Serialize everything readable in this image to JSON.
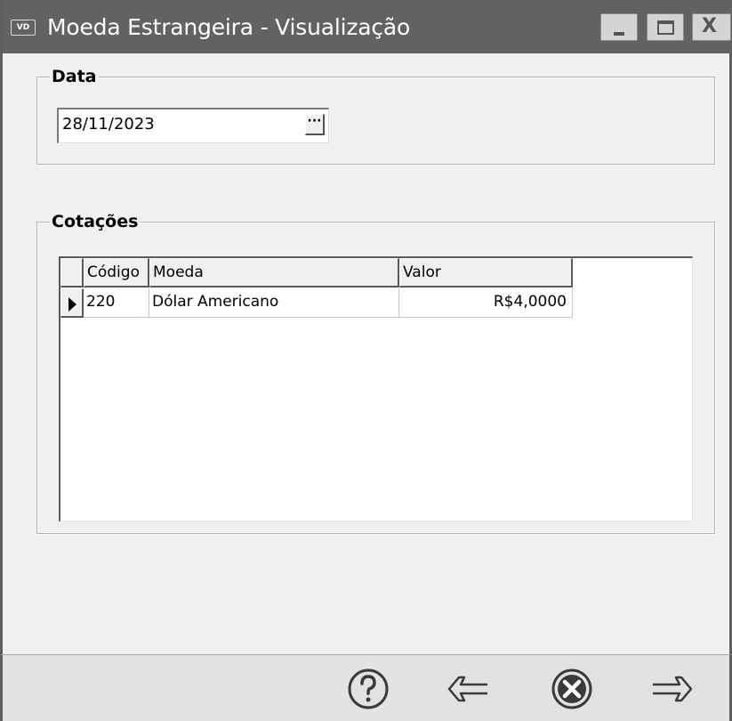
{
  "window": {
    "app_icon_text": "VD",
    "title": "Moeda Estrangeira - Visualização",
    "controls": {
      "minimize": "minimize-icon",
      "maximize": "maximize-icon",
      "close": "X"
    }
  },
  "date_section": {
    "label": "Data",
    "date_value": "28/11/2023",
    "picker_button_label": "···"
  },
  "quotes_section": {
    "label": "Cotações",
    "columns": [
      "Código",
      "Moeda",
      "Valor"
    ],
    "rows": [
      {
        "code": "220",
        "currency": "Dólar Americano",
        "value": "R$4,0000"
      }
    ]
  },
  "footer": {
    "buttons": [
      "help-icon",
      "arrow-left-icon",
      "cancel-icon",
      "arrow-right-icon"
    ]
  },
  "colors": {
    "titlebar": "#626262",
    "background": "#f0f0f0",
    "footer": "#e2e2e2"
  }
}
